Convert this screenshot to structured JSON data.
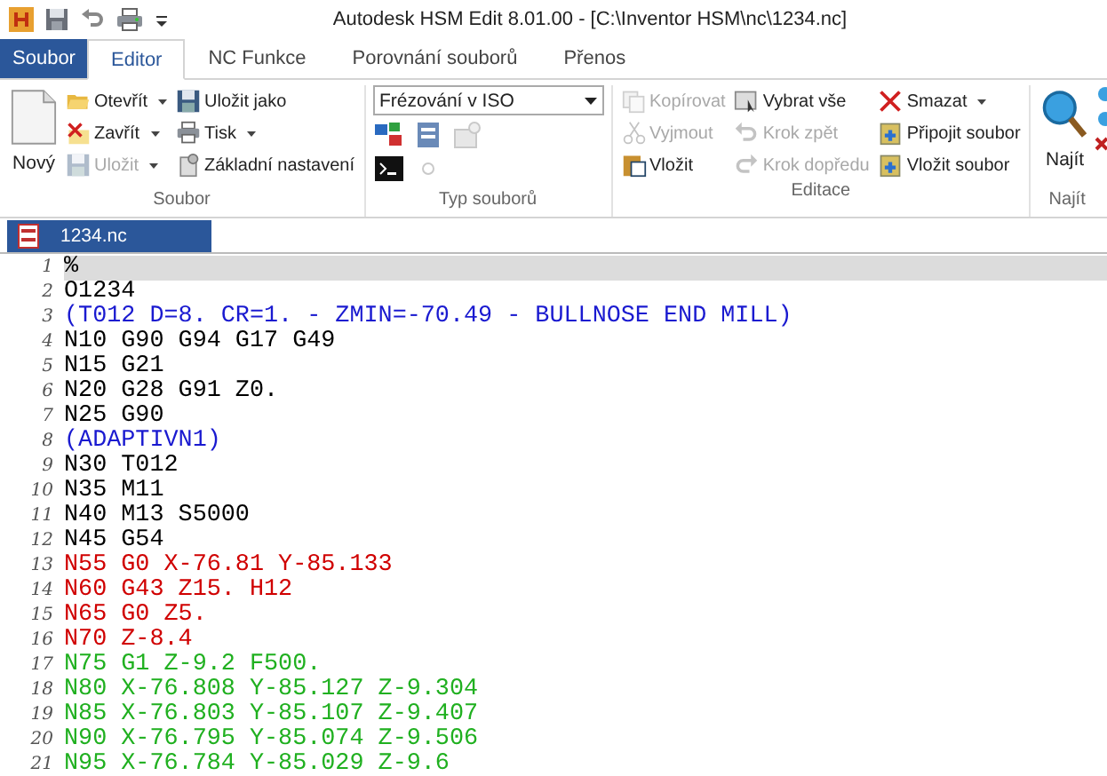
{
  "window": {
    "title": "Autodesk HSM Edit 8.01.00 - [C:\\Inventor HSM\\nc\\1234.nc]"
  },
  "file_tab": {
    "label": "Soubor"
  },
  "tabs": [
    {
      "label": "Editor",
      "selected": true
    },
    {
      "label": "NC Funkce",
      "selected": false
    },
    {
      "label": "Porovnání souborů",
      "selected": false
    },
    {
      "label": "Přenos",
      "selected": false
    }
  ],
  "ribbon": {
    "soubor": {
      "new": "Nový",
      "items": [
        {
          "label": "Otevřít",
          "dropdown": true,
          "disabled": false
        },
        {
          "label": "Zavřít",
          "dropdown": true,
          "disabled": false
        },
        {
          "label": "Uložit",
          "dropdown": true,
          "disabled": true
        },
        {
          "label": "Uložit jako",
          "dropdown": false,
          "disabled": false
        },
        {
          "label": "Tisk",
          "dropdown": true,
          "disabled": false
        },
        {
          "label": "Základní nastavení",
          "dropdown": false,
          "disabled": false
        }
      ],
      "group_label": "Soubor"
    },
    "typ": {
      "dropdown_value": "Frézování v ISO",
      "group_label": "Typ souborů"
    },
    "editace": {
      "items": [
        {
          "label": "Kopírovat",
          "dropdown": false,
          "disabled": true
        },
        {
          "label": "Vyjmout",
          "dropdown": false,
          "disabled": true
        },
        {
          "label": "Vložit",
          "dropdown": false,
          "disabled": false
        },
        {
          "label": "Vybrat vše",
          "dropdown": false,
          "disabled": false
        },
        {
          "label": "Krok zpět",
          "dropdown": false,
          "disabled": true
        },
        {
          "label": "Krok dopředu",
          "dropdown": false,
          "disabled": true
        },
        {
          "label": "Smazat",
          "dropdown": true,
          "disabled": false
        },
        {
          "label": "Připojit soubor",
          "dropdown": false,
          "disabled": false
        },
        {
          "label": "Vložit soubor",
          "dropdown": false,
          "disabled": false
        }
      ],
      "group_label": "Editace"
    },
    "najit": {
      "label": "Najít",
      "group_label": "Najít"
    }
  },
  "document_tab": {
    "label": "1234.nc"
  },
  "editor": {
    "lines": [
      {
        "number": "1",
        "text": "%",
        "color": "#000000",
        "current": true
      },
      {
        "number": "2",
        "text": "O1234",
        "color": "#000000",
        "current": false
      },
      {
        "number": "3",
        "text": "(T012 D=8. CR=1. - ZMIN=-70.49 - BULLNOSE END MILL)",
        "color": "#1a1ad0",
        "current": false
      },
      {
        "number": "4",
        "text": "N10 G90 G94 G17 G49",
        "color": "#000000",
        "current": false
      },
      {
        "number": "5",
        "text": "N15 G21",
        "color": "#000000",
        "current": false
      },
      {
        "number": "6",
        "text": "N20 G28 G91 Z0.",
        "color": "#000000",
        "current": false
      },
      {
        "number": "7",
        "text": "N25 G90",
        "color": "#000000",
        "current": false
      },
      {
        "number": "8",
        "text": "(ADAPTIVN1)",
        "color": "#1a1ad0",
        "current": false
      },
      {
        "number": "9",
        "text": "N30 T012",
        "color": "#000000",
        "current": false
      },
      {
        "number": "10",
        "text": "N35 M11",
        "color": "#000000",
        "current": false
      },
      {
        "number": "11",
        "text": "N40 M13 S5000",
        "color": "#000000",
        "current": false
      },
      {
        "number": "12",
        "text": "N45 G54",
        "color": "#000000",
        "current": false
      },
      {
        "number": "13",
        "text": "N55 G0 X-76.81 Y-85.133",
        "color": "#d00000",
        "current": false
      },
      {
        "number": "14",
        "text": "N60 G43 Z15. H12",
        "color": "#d00000",
        "current": false
      },
      {
        "number": "15",
        "text": "N65 G0 Z5.",
        "color": "#d00000",
        "current": false
      },
      {
        "number": "16",
        "text": "N70 Z-8.4",
        "color": "#d00000",
        "current": false
      },
      {
        "number": "17",
        "text": "N75 G1 Z-9.2 F500.",
        "color": "#20b020",
        "current": false
      },
      {
        "number": "18",
        "text": "N80 X-76.808 Y-85.127 Z-9.304",
        "color": "#20b020",
        "current": false
      },
      {
        "number": "19",
        "text": "N85 X-76.803 Y-85.107 Z-9.407",
        "color": "#20b020",
        "current": false
      },
      {
        "number": "20",
        "text": "N90 X-76.795 Y-85.074 Z-9.506",
        "color": "#20b020",
        "current": false
      },
      {
        "number": "21",
        "text": "N95 X-76.784 Y-85.029 Z-9.6",
        "color": "#20b020",
        "current": false
      }
    ]
  }
}
